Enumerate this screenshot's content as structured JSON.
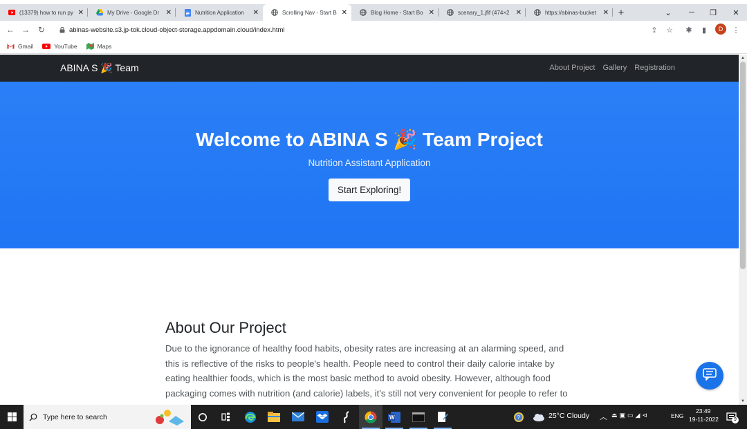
{
  "browser": {
    "tabs": [
      {
        "title": "(13379) how to run py",
        "icon": "youtube-icon",
        "active": false
      },
      {
        "title": "My Drive - Google Dr",
        "icon": "google-drive-icon",
        "active": false
      },
      {
        "title": "Nutrition Application",
        "icon": "google-docs-icon",
        "active": false
      },
      {
        "title": "Scrolling Nav - Start B",
        "icon": "globe-icon",
        "active": true
      },
      {
        "title": "Blog Home - Start Bo",
        "icon": "globe-icon",
        "active": false
      },
      {
        "title": "scenary_1.jfif (474×2",
        "icon": "globe-icon",
        "active": false
      },
      {
        "title": "https://abinas-bucket",
        "icon": "globe-icon",
        "active": false
      }
    ],
    "url": "abinas-website.s3.jp-tok.cloud-object-storage.appdomain.cloud/index.html",
    "profile_initial": "D",
    "bookmarks": [
      {
        "label": "Gmail",
        "icon": "gmail-icon"
      },
      {
        "label": "YouTube",
        "icon": "youtube-icon"
      },
      {
        "label": "Maps",
        "icon": "maps-icon"
      }
    ]
  },
  "site": {
    "brand": "ABINA S 🎉 Team",
    "nav_links": [
      "About Project",
      "Gallery",
      "Registration"
    ],
    "hero": {
      "title": "Welcome to ABINA S 🎉 Team Project",
      "subtitle": "Nutrition Assistant Application",
      "button": "Start Exploring!"
    },
    "about": {
      "heading": "About Our Project",
      "body": "Due to the ignorance of healthy food habits, obesity rates are increasing at an alarming speed, and this is reflective of the risks to people's health. People need to control their daily calorie intake by eating healthier foods, which is the most basic method to avoid obesity. However, although food packaging comes with nutrition (and calorie) labels, it's still not very convenient for people to refer to"
    }
  },
  "taskbar": {
    "search_placeholder": "Type here to search",
    "weather": "25°C  Cloudy",
    "language": "ENG",
    "time": "23:49",
    "date": "19-11-2022",
    "notification_count": "9"
  },
  "colors": {
    "hero_blue": "#2b7ff7",
    "navbar_dark": "#212529",
    "chat_blue": "#1a73e8"
  }
}
